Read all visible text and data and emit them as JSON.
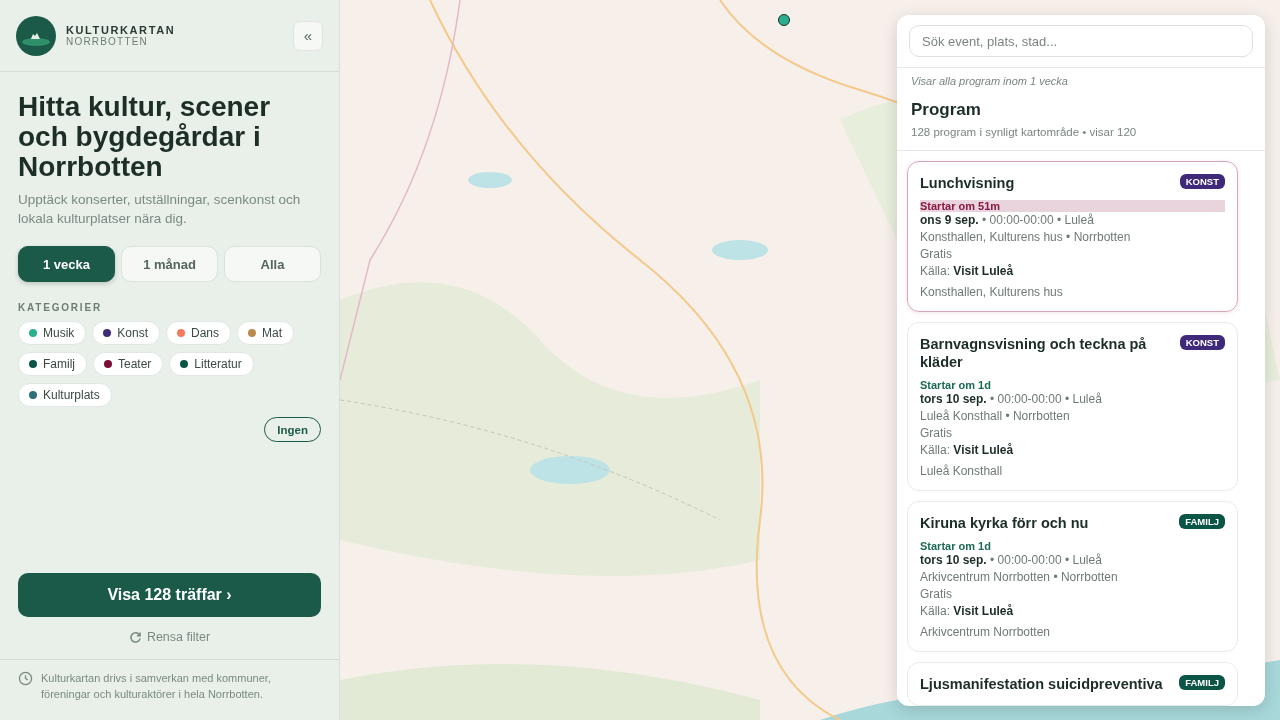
{
  "brand": {
    "name": "KULTURKARTAN",
    "region": "NORRBOTTEN",
    "collapse": "«"
  },
  "heading": "Hitta kultur, scener och bygdegårdar i Norrbotten",
  "intro": "Upptäck konserter, utställningar, scenkonst och lokala kulturplatser nära dig.",
  "periods": [
    {
      "label": "1 vecka",
      "selected": true
    },
    {
      "label": "1 månad",
      "selected": false
    },
    {
      "label": "Alla",
      "selected": false
    }
  ],
  "categories_label": "KATEGORIER",
  "categories": [
    {
      "label": "Musik",
      "color": "#2bb08f"
    },
    {
      "label": "Konst",
      "color": "#3f2a7a"
    },
    {
      "label": "Dans",
      "color": "#f37a5a"
    },
    {
      "label": "Mat",
      "color": "#b98a4a"
    },
    {
      "label": "Familj",
      "color": "#0b5547"
    },
    {
      "label": "Teater",
      "color": "#7a0e3a"
    },
    {
      "label": "Litteratur",
      "color": "#0b5547"
    },
    {
      "label": "Kulturplats",
      "color": "#2e6f7a"
    }
  ],
  "none_button": "Ingen",
  "show_button": "Visa 128 träffar ›",
  "reset": "Rensa filter",
  "footer": "Kulturkartan drivs i samverkan med kommuner, föreningar och kulturaktörer i hela Norrbotten.",
  "panel": {
    "search": {
      "placeholder": "Sök event, plats, stad..."
    },
    "scope": "Visar alla program inom 1 vecka",
    "title": "Program",
    "summary": "128 program i synligt kartområde • visar 120",
    "events": [
      {
        "title": "Lunchvisning",
        "tag": "KONST",
        "color": "#3f2a7a",
        "soon": true,
        "starts": "Startar om 51m",
        "when": "**ons 9 sep.** • 00:00-00:00 • Luleå",
        "venue": "Konsthallen, Kulturens hus • Norrbotten",
        "price": "Gratis",
        "source": "Källa: **Visit Luleå**",
        "location": "Konsthallen, Kulturens hus"
      },
      {
        "title": "Barnvagnsvisning och teckna på kläder",
        "tag": "KONST",
        "color": "#3f2a7a",
        "soon": false,
        "starts": "Startar om 1d",
        "when": "**tors 10 sep.** • 00:00-00:00 • Luleå",
        "venue": "Luleå Konsthall • Norrbotten",
        "price": "Gratis",
        "source": "Källa: **Visit Luleå**",
        "location": "Luleå Konsthall"
      },
      {
        "title": "Kiruna kyrka förr och nu",
        "tag": "FAMILJ",
        "color": "#0b5547",
        "soon": false,
        "starts": "Startar om 1d",
        "when": "**tors 10 sep.** • 00:00-00:00 • Luleå",
        "venue": "Arkivcentrum Norrbotten • Norrbotten",
        "price": "Gratis",
        "source": "Källa: **Visit Luleå**",
        "location": "Arkivcentrum Norrbotten"
      },
      {
        "title": "Ljusmanifestation suicidpreventiva",
        "tag": "FAMILJ",
        "color": "#0b5547",
        "soon": false
      }
    ]
  }
}
